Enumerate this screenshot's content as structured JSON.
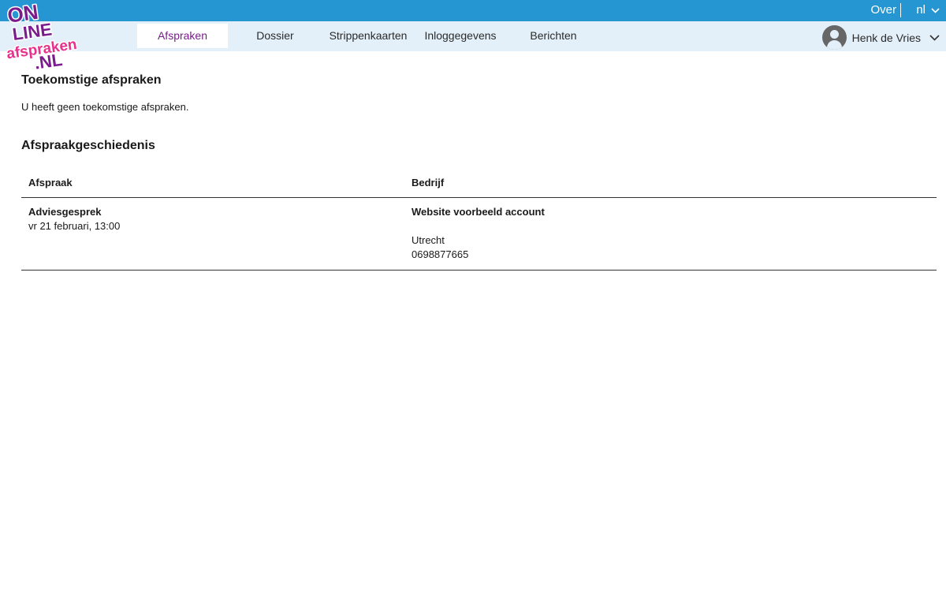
{
  "topbar": {
    "over_label": "Over",
    "language": "nl"
  },
  "logo": {
    "line1": "ON",
    "line2": "LINE",
    "line3": "afspraken",
    "line4": ".NL"
  },
  "nav": {
    "tabs": [
      {
        "label": "Afspraken",
        "active": true
      },
      {
        "label": "Dossier"
      },
      {
        "label": "Strippenkaarten"
      },
      {
        "label": "Inloggegevens"
      },
      {
        "label": "Berichten"
      }
    ]
  },
  "user": {
    "name": "Henk de Vries"
  },
  "upcoming": {
    "title": "Toekomstige afspraken",
    "empty_message": "U heeft geen toekomstige afspraken."
  },
  "history": {
    "title": "Afspraakgeschiedenis",
    "columns": [
      "Afspraak",
      "Bedrijf"
    ],
    "rows": [
      {
        "appointment": "Adviesgesprek",
        "datetime": "vr 21 februari, 13:00",
        "company": "Website voorbeeld account",
        "city": "Utrecht",
        "phone": "0698877665"
      }
    ]
  },
  "colors": {
    "topbar": "#2596d2",
    "navbar": "#e3f0fa",
    "brand_purple": "#7a1c8c",
    "logo_pink": "#e8308c"
  }
}
